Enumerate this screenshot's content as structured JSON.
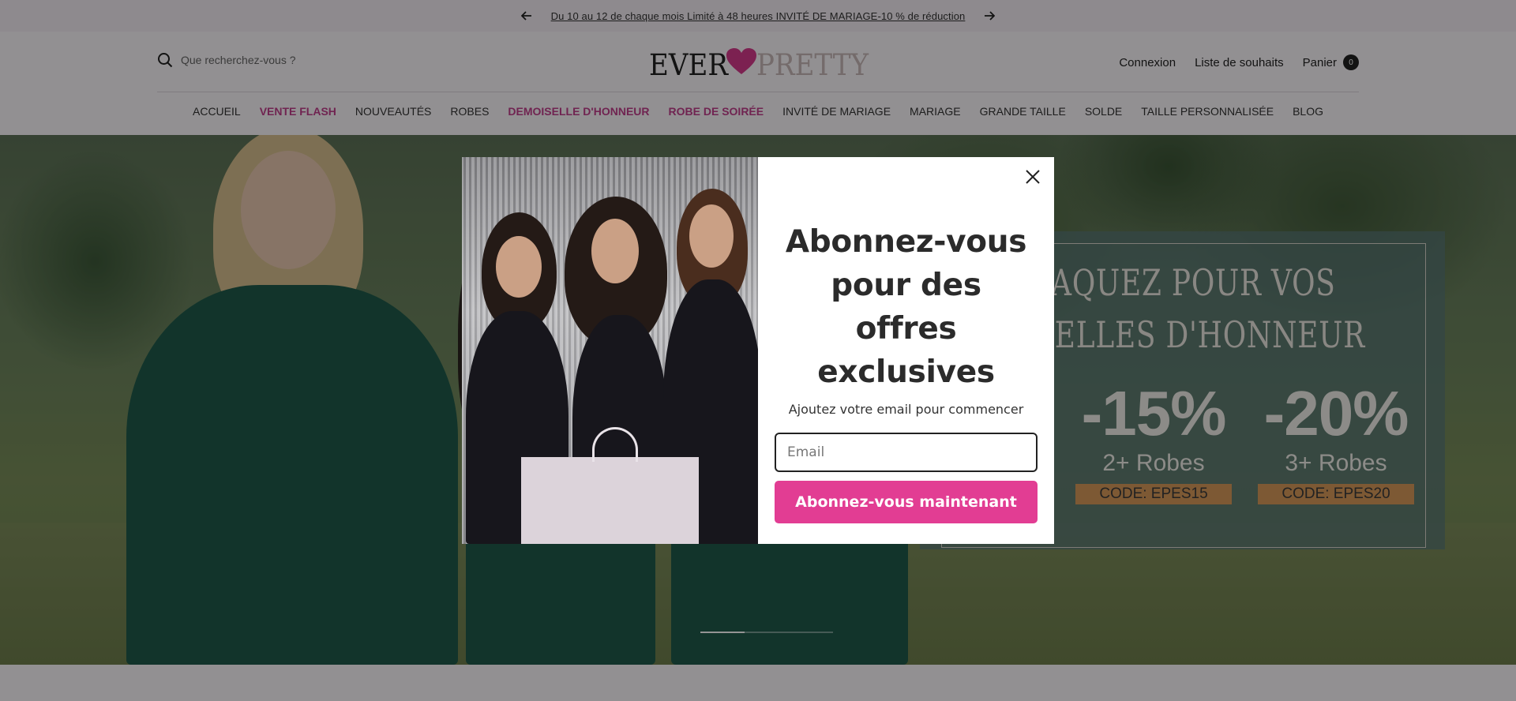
{
  "announcement": {
    "message": "Du 10 au 12 de chaque mois Limité à 48 heures  INVITÉ DE MARIAGE-10 % de réduction",
    "prev_icon": "arrow-left-icon",
    "next_icon": "arrow-right-icon"
  },
  "header": {
    "search_placeholder": "Que recherchez-vous ?",
    "logo_text_left": "EVER",
    "logo_text_right": "PRETTY",
    "logo_heart_color": "#d63a8c",
    "links": {
      "login": "Connexion",
      "wishlist": "Liste de souhaits",
      "cart": "Panier",
      "cart_count": "0"
    }
  },
  "nav": {
    "items": [
      {
        "label": "ACCUEIL"
      },
      {
        "label": "VENTE FLASH"
      },
      {
        "label": "NOUVEAUTÉS"
      },
      {
        "label": "ROBES"
      },
      {
        "label": "DEMOISELLE D'HONNEUR"
      },
      {
        "label": "ROBE DE SOIRÉE"
      },
      {
        "label": "INVITÉ DE MARIAGE"
      },
      {
        "label": "MARIAGE"
      },
      {
        "label": "GRANDE TAILLE"
      },
      {
        "label": "SOLDE"
      },
      {
        "label": "TAILLE PERSONNALISÉE"
      },
      {
        "label": "BLOG"
      }
    ],
    "highlight_color": "#c23e8c"
  },
  "hero": {
    "promo_line1": "RAQUEZ POUR VOS",
    "promo_line2": "DISELLES D'HONNEUR",
    "deals": [
      {
        "percent": "-15%",
        "qty": "2+ Robes",
        "code": "CODE: EPES15"
      },
      {
        "percent": "-20%",
        "qty": "3+ Robes",
        "code": "CODE: EPES20"
      }
    ]
  },
  "modal": {
    "title": "Abonnez-vous pour des offres exclusives",
    "subtitle": "Ajoutez votre email pour commencer",
    "email_placeholder": "Email",
    "email_value": "",
    "submit_label": "Abonnez-vous maintenant",
    "accent_color": "#e23d93",
    "close_icon": "close-icon"
  }
}
